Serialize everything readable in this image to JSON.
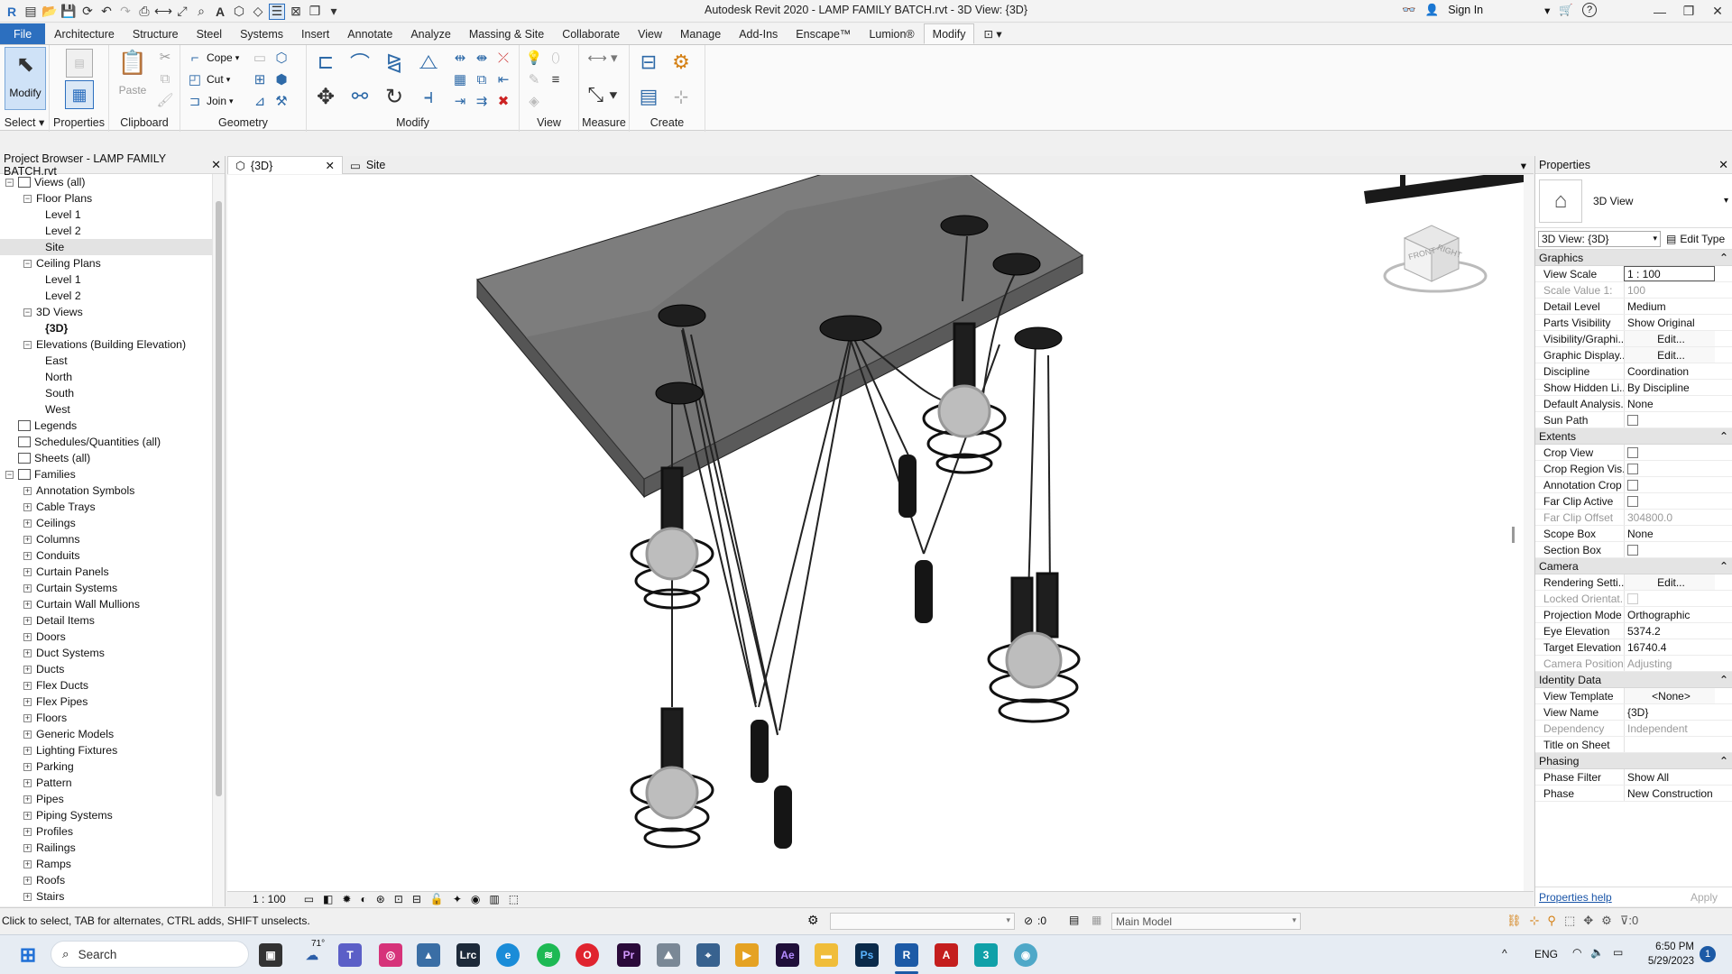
{
  "window": {
    "title": "Autodesk Revit 2020 - LAMP FAMILY BATCH.rvt - 3D View: {3D}",
    "sign_in": "Sign In",
    "help": "?"
  },
  "tabs": [
    "File",
    "Architecture",
    "Structure",
    "Steel",
    "Systems",
    "Insert",
    "Annotate",
    "Analyze",
    "Massing & Site",
    "Collaborate",
    "View",
    "Manage",
    "Add-Ins",
    "Enscape™",
    "Lumion®",
    "Modify"
  ],
  "ribbon": {
    "modify_label": "Modify",
    "select_label": "Select",
    "properties_label": "Properties",
    "paste_label": "Paste",
    "clipboard_label": "Clipboard",
    "cope_label": "Cope",
    "cut_label": "Cut",
    "join_label": "Join",
    "geometry_label": "Geometry",
    "modify_panel_label": "Modify",
    "view_label": "View",
    "measure_label": "Measure",
    "create_label": "Create"
  },
  "project_browser": {
    "title": "Project Browser - LAMP FAMILY BATCH.rvt",
    "items": [
      {
        "label": "Views (all)",
        "level": 0,
        "exp": "−"
      },
      {
        "label": "Floor Plans",
        "level": 1,
        "exp": "−"
      },
      {
        "label": "Level 1",
        "level": 2,
        "exp": ""
      },
      {
        "label": "Level 2",
        "level": 2,
        "exp": ""
      },
      {
        "label": "Site",
        "level": 2,
        "exp": "",
        "selected": true
      },
      {
        "label": "Ceiling Plans",
        "level": 1,
        "exp": "−"
      },
      {
        "label": "Level 1",
        "level": 2,
        "exp": ""
      },
      {
        "label": "Level 2",
        "level": 2,
        "exp": ""
      },
      {
        "label": "3D Views",
        "level": 1,
        "exp": "−"
      },
      {
        "label": "{3D}",
        "level": 2,
        "exp": "",
        "bold": true
      },
      {
        "label": "Elevations (Building Elevation)",
        "level": 1,
        "exp": "−"
      },
      {
        "label": "East",
        "level": 2,
        "exp": ""
      },
      {
        "label": "North",
        "level": 2,
        "exp": ""
      },
      {
        "label": "South",
        "level": 2,
        "exp": ""
      },
      {
        "label": "West",
        "level": 2,
        "exp": ""
      },
      {
        "label": "Legends",
        "level": 0,
        "exp": "",
        "icon": true
      },
      {
        "label": "Schedules/Quantities (all)",
        "level": 0,
        "exp": "",
        "icon": true
      },
      {
        "label": "Sheets (all)",
        "level": 0,
        "exp": "",
        "icon": true
      },
      {
        "label": "Families",
        "level": 0,
        "exp": "−",
        "icon": true
      },
      {
        "label": "Annotation Symbols",
        "level": 1,
        "exp": "+"
      },
      {
        "label": "Cable Trays",
        "level": 1,
        "exp": "+"
      },
      {
        "label": "Ceilings",
        "level": 1,
        "exp": "+"
      },
      {
        "label": "Columns",
        "level": 1,
        "exp": "+"
      },
      {
        "label": "Conduits",
        "level": 1,
        "exp": "+"
      },
      {
        "label": "Curtain Panels",
        "level": 1,
        "exp": "+"
      },
      {
        "label": "Curtain Systems",
        "level": 1,
        "exp": "+"
      },
      {
        "label": "Curtain Wall Mullions",
        "level": 1,
        "exp": "+"
      },
      {
        "label": "Detail Items",
        "level": 1,
        "exp": "+"
      },
      {
        "label": "Doors",
        "level": 1,
        "exp": "+"
      },
      {
        "label": "Duct Systems",
        "level": 1,
        "exp": "+"
      },
      {
        "label": "Ducts",
        "level": 1,
        "exp": "+"
      },
      {
        "label": "Flex Ducts",
        "level": 1,
        "exp": "+"
      },
      {
        "label": "Flex Pipes",
        "level": 1,
        "exp": "+"
      },
      {
        "label": "Floors",
        "level": 1,
        "exp": "+"
      },
      {
        "label": "Generic Models",
        "level": 1,
        "exp": "+"
      },
      {
        "label": "Lighting Fixtures",
        "level": 1,
        "exp": "+"
      },
      {
        "label": "Parking",
        "level": 1,
        "exp": "+"
      },
      {
        "label": "Pattern",
        "level": 1,
        "exp": "+"
      },
      {
        "label": "Pipes",
        "level": 1,
        "exp": "+"
      },
      {
        "label": "Piping Systems",
        "level": 1,
        "exp": "+"
      },
      {
        "label": "Profiles",
        "level": 1,
        "exp": "+"
      },
      {
        "label": "Railings",
        "level": 1,
        "exp": "+"
      },
      {
        "label": "Ramps",
        "level": 1,
        "exp": "+"
      },
      {
        "label": "Roofs",
        "level": 1,
        "exp": "+"
      },
      {
        "label": "Stairs",
        "level": 1,
        "exp": "+"
      }
    ]
  },
  "view_tabs": [
    {
      "label": "{3D}",
      "active": true
    },
    {
      "label": "Site",
      "active": false
    }
  ],
  "viewcube": {
    "front": "FRONT",
    "right": "RIGHT"
  },
  "view_scale": "1 : 100",
  "properties": {
    "title": "Properties",
    "type_name": "3D View",
    "selector": "3D View: {3D}",
    "edit_type": "Edit Type",
    "groups": [
      {
        "name": "Graphics",
        "rows": [
          {
            "k": "View Scale",
            "v": "1 : 100"
          },
          {
            "k": "Scale Value   1:",
            "v": "100",
            "dis": true
          },
          {
            "k": "Detail Level",
            "v": "Medium"
          },
          {
            "k": "Parts Visibility",
            "v": "Show Original"
          },
          {
            "k": "Visibility/Graphi...",
            "v": "Edit...",
            "btn": true
          },
          {
            "k": "Graphic Display...",
            "v": "Edit...",
            "btn": true
          },
          {
            "k": "Discipline",
            "v": "Coordination"
          },
          {
            "k": "Show Hidden Li...",
            "v": "By Discipline"
          },
          {
            "k": "Default Analysis...",
            "v": "None"
          },
          {
            "k": "Sun Path",
            "v": "",
            "cb": true
          }
        ]
      },
      {
        "name": "Extents",
        "rows": [
          {
            "k": "Crop View",
            "v": "",
            "cb": true
          },
          {
            "k": "Crop Region Vis...",
            "v": "",
            "cb": true
          },
          {
            "k": "Annotation Crop",
            "v": "",
            "cb": true
          },
          {
            "k": "Far Clip Active",
            "v": "",
            "cb": true
          },
          {
            "k": "Far Clip Offset",
            "v": "304800.0",
            "dis": true
          },
          {
            "k": "Scope Box",
            "v": "None"
          },
          {
            "k": "Section Box",
            "v": "",
            "cb": true
          }
        ]
      },
      {
        "name": "Camera",
        "rows": [
          {
            "k": "Rendering Setti...",
            "v": "Edit...",
            "btn": true
          },
          {
            "k": "Locked Orientat...",
            "v": "",
            "cb": true,
            "dis": true
          },
          {
            "k": "Projection Mode",
            "v": "Orthographic"
          },
          {
            "k": "Eye Elevation",
            "v": "5374.2"
          },
          {
            "k": "Target Elevation",
            "v": "16740.4"
          },
          {
            "k": "Camera Position",
            "v": "Adjusting",
            "dis": true
          }
        ]
      },
      {
        "name": "Identity Data",
        "rows": [
          {
            "k": "View Template",
            "v": "<None>",
            "btn": true
          },
          {
            "k": "View Name",
            "v": "{3D}"
          },
          {
            "k": "Dependency",
            "v": "Independent",
            "dis": true
          },
          {
            "k": "Title on Sheet",
            "v": ""
          }
        ]
      },
      {
        "name": "Phasing",
        "rows": [
          {
            "k": "Phase Filter",
            "v": "Show All"
          },
          {
            "k": "Phase",
            "v": "New Construction"
          }
        ]
      }
    ],
    "help_link": "Properties help",
    "apply": "Apply"
  },
  "status": {
    "hint": "Click to select, TAB for alternates, CTRL adds, SHIFT unselects.",
    "zero": ":0",
    "model": "Main Model",
    "filter_count": ":0"
  },
  "taskbar": {
    "search": "Search",
    "temp": "71°",
    "lang": "ENG",
    "time": "6:50 PM",
    "date": "5/29/2023",
    "notif": "1"
  }
}
